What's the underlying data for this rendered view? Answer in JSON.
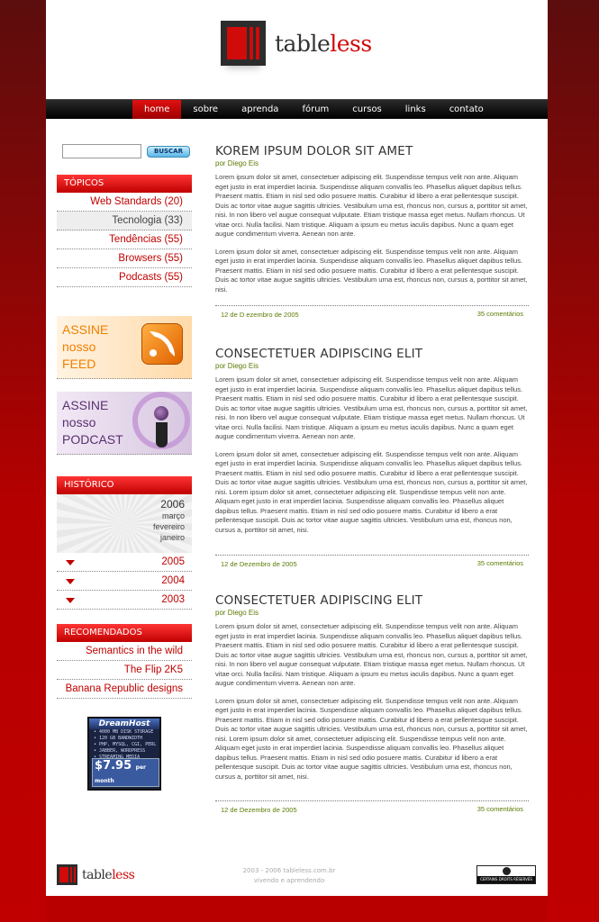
{
  "brand": {
    "logo_main": "table",
    "logo_accent": "less",
    "accent": "#d10a0a"
  },
  "nav": [
    {
      "label": "home"
    },
    {
      "label": "sobre"
    },
    {
      "label": "aprenda"
    },
    {
      "label": "fórum"
    },
    {
      "label": "cursos"
    },
    {
      "label": "links"
    },
    {
      "label": "contato"
    }
  ],
  "search": {
    "button": "BUSCAR",
    "value": ""
  },
  "sidebar": {
    "topics_title": "TÓPICOS",
    "topics": [
      "Web Standards (20)",
      "Tecnologia (33)",
      "Tendências (55)",
      "Browsers (55)",
      "Podcasts (55)"
    ],
    "feed": {
      "line1": "ASSINE",
      "line2": "nosso",
      "line3": "FEED",
      "icon": "rss-icon"
    },
    "podcast": {
      "line1": "ASSINE",
      "line2": "nosso",
      "line3": "PODCAST",
      "icon": "microphone-icon"
    },
    "history_title": "HISTÓRICO",
    "history_current": "2006",
    "history_months": [
      "março",
      "fevereiro",
      "janeiro"
    ],
    "history_years": [
      "2005",
      "2004",
      "2003"
    ],
    "recommended_title": "RECOMENDADOS",
    "recommended": [
      "Semantics in the wild",
      "The Flip 2K5",
      "Banana Republic designs"
    ],
    "ad": {
      "title": "DreamHost",
      "lines": [
        "• 4000 MB DISK STORAGE",
        "• 120 GB BANDWIDTH",
        "• PHP, MYSQL, CGI, PERL",
        "• JABBER, WORDPRESS",
        "• STREAMING MEDIA"
      ],
      "price": "$7.95",
      "price_unit": "per month"
    }
  },
  "posts": [
    {
      "title": "KOREM IPSUM DOLOR SIT AMET",
      "author": "por Diego Eis",
      "paragraphs": [
        "Lorem ipsum dolor sit amet, consectetuer adipiscing elit. Suspendisse tempus velit non ante. Aliquam eget justo in erat imperdiet lacinia. Suspendisse aliquam convallis leo. Phasellus aliquet dapibus tellus. Praesent mattis. Etiam in nisl sed odio posuere mattis. Curabitur id libero a erat pellentesque suscipit. Duis ac tortor vitae augue sagittis ultricies. Vestibulum urna est, rhoncus non, cursus a, porttitor sit amet, nisi. In non libero vel augue consequat vulputate. Etiam tristique massa eget metus. Nullam rhoncus. Ut vitae orci. Nulla facilisi. Nam tristique. Aliquam a ipsum eu metus iaculis dapibus. Nunc a quam eget augue condimentum viverra. Aenean non ante.",
        "Lorem ipsum dolor sit amet, consectetuer adipiscing elit. Suspendisse tempus velit non ante. Aliquam eget justo in erat imperdiet lacinia. Suspendisse aliquam convallis leo. Phasellus aliquet dapibus tellus. Praesent mattis. Etiam in nisl sed odio posuere mattis. Curabitur id libero a erat pellentesque suscipit. Duis ac tortor vitae augue sagittis ultricies. Vestibulum urna est, rhoncus non, cursus a, porttitor sit amet, nisi."
      ],
      "date": "12 de D ezembro de 2005",
      "comments": "35 comentários"
    },
    {
      "title": "CONSECTETUER ADIPISCING ELIT",
      "author": "por Diego Eis",
      "paragraphs": [
        "Lorem ipsum dolor sit amet, consectetuer adipiscing elit. Suspendisse tempus velit non ante. Aliquam eget justo in erat imperdiet lacinia. Suspendisse aliquam convallis leo. Phasellus aliquet dapibus tellus. Praesent mattis. Etiam in nisl sed odio posuere mattis. Curabitur id libero a erat pellentesque suscipit. Duis ac tortor vitae augue sagittis ultricies. Vestibulum urna est, rhoncus non, cursus a, porttitor sit amet, nisi. In non libero vel augue consequat vulputate. Etiam tristique massa eget metus. Nullam rhoncus. Ut vitae orci. Nulla facilisi. Nam tristique. Aliquam a ipsum eu metus iaculis dapibus. Nunc a quam eget augue condimentum viverra. Aenean non ante.",
        "Lorem ipsum dolor sit amet, consectetuer adipiscing elit. Suspendisse tempus velit non ante. Aliquam eget justo in erat imperdiet lacinia. Suspendisse aliquam convallis leo. Phasellus aliquet dapibus tellus. Praesent mattis. Etiam in nisl sed odio posuere mattis. Curabitur id libero a erat pellentesque suscipit. Duis ac tortor vitae augue sagittis ultricies. Vestibulum urna est, rhoncus non, cursus a, porttitor sit amet, nisi. Lorem ipsum dolor sit amet, consectetuer adipiscing elit. Suspendisse tempus velit non ante. Aliquam eget justo in erat imperdiet lacinia. Suspendisse aliquam convallis leo. Phasellus aliquet dapibus tellus. Praesent mattis. Etiam in nisl sed odio posuere mattis. Curabitur id libero a erat pellentesque suscipit. Duis ac tortor vitae augue sagittis ultricies. Vestibulum urna est, rhoncus non, cursus a, porttitor sit amet, nisi."
      ],
      "date": "12 de Dezembro de 2005",
      "comments": "35 comentários"
    },
    {
      "title": "CONSECTETUER ADIPISCING ELIT",
      "author": "por Diego Eis",
      "paragraphs": [
        "Lorem ipsum dolor sit amet, consectetuer adipiscing elit. Suspendisse tempus velit non ante. Aliquam eget justo in erat imperdiet lacinia. Suspendisse aliquam convallis leo. Phasellus aliquet dapibus tellus. Praesent mattis. Etiam in nisl sed odio posuere mattis. Curabitur id libero a erat pellentesque suscipit. Duis ac tortor vitae augue sagittis ultricies. Vestibulum urna est, rhoncus non, cursus a, porttitor sit amet, nisi. In non libero vel augue consequat vulputate. Etiam tristique massa eget metus. Nullam rhoncus. Ut vitae orci. Nulla facilisi. Nam tristique. Aliquam a ipsum eu metus iaculis dapibus. Nunc a quam eget augue condimentum viverra. Aenean non ante.",
        "Lorem ipsum dolor sit amet, consectetuer adipiscing elit. Suspendisse tempus velit non ante. Aliquam eget justo in erat imperdiet lacinia. Suspendisse aliquam convallis leo. Phasellus aliquet dapibus tellus. Praesent mattis. Etiam in nisl sed odio posuere mattis. Curabitur id libero a erat pellentesque suscipit. Duis ac tortor vitae augue sagittis ultricies. Vestibulum urna est, rhoncus non, cursus a, porttitor sit amet, nisi. Lorem ipsum dolor sit amet, consectetuer adipiscing elit. Suspendisse tempus velit non ante. Aliquam eget justo in erat imperdiet lacinia. Suspendisse aliquam convallis leo. Phasellus aliquet dapibus tellus. Praesent mattis. Etiam in nisl sed odio posuere mattis. Curabitur id libero a erat pellentesque suscipit. Duis ac tortor vitae augue sagittis ultricies. Vestibulum urna est, rhoncus non, cursus a, porttitor sit amet, nisi."
      ],
      "date": "12 de Dezembro de 2005",
      "comments": "35 comentários"
    }
  ],
  "footer": {
    "copyright": "2003 - 2006 tableless.com.br",
    "tagline": "vivendo e aprendendo",
    "license": "CERTAINS DROITS RÉSERVÉS"
  }
}
